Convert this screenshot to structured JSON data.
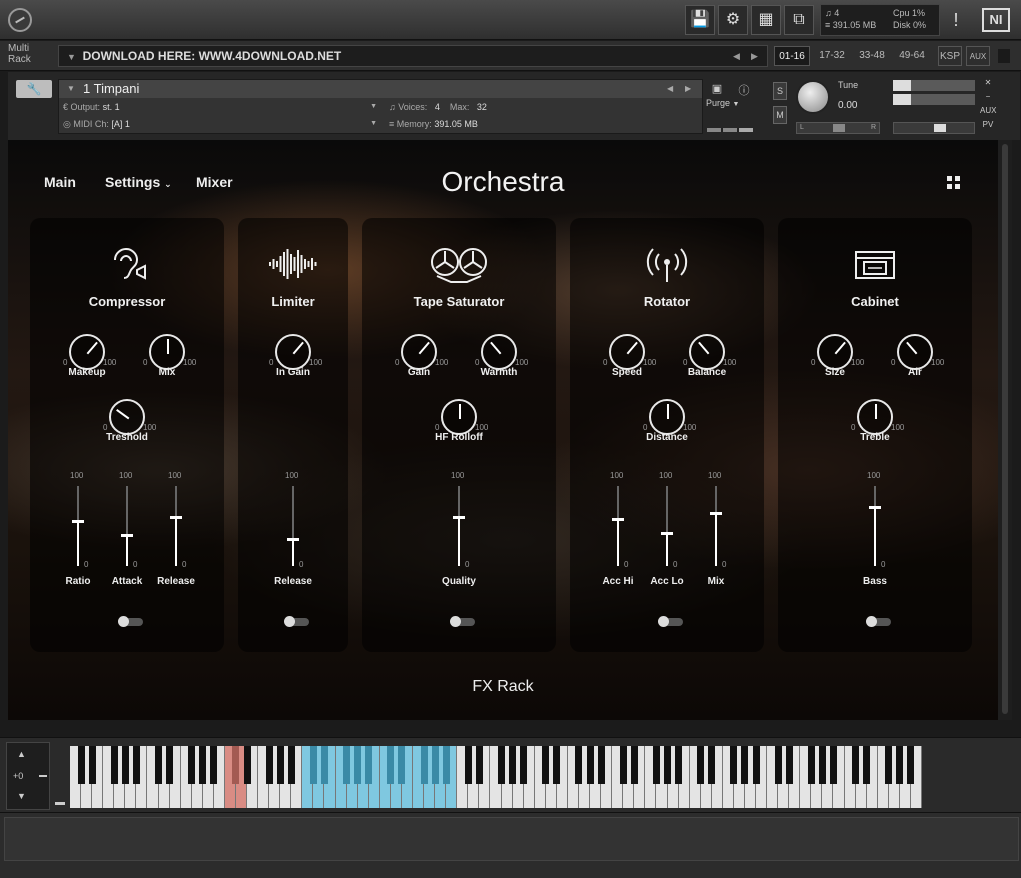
{
  "topbar": {
    "buttons": [
      "save-icon",
      "gear-icon",
      "layout-icon",
      "window-icon"
    ],
    "voices": "4",
    "memory": "391.05 MB",
    "cpu_label": "Cpu",
    "cpu_value": "1%",
    "disk_label": "Disk",
    "disk_value": "0%",
    "warning": "!",
    "ni_logo": "NI"
  },
  "rackbar": {
    "multirack": "Multi Rack",
    "preset": "DOWNLOAD HERE: WWW.4DOWNLOAD.NET",
    "pages": [
      "01-16",
      "17-32",
      "33-48",
      "49-64",
      "KSP",
      "AUX"
    ],
    "active_page": "01-16"
  },
  "instrument": {
    "name": "1 Timpani",
    "output_label": "Output:",
    "output_value": "st. 1",
    "voices_label": "Voices:",
    "voices_value": "4",
    "max_label": "Max:",
    "max_value": "32",
    "midi_label": "MIDI Ch:",
    "midi_value": "[A]  1",
    "memory_label": "Memory:",
    "memory_value": "391.05 MB",
    "purge": "Purge",
    "s": "S",
    "m": "M",
    "tune_label": "Tune",
    "tune_value": "0.00",
    "l": "L",
    "r": "R",
    "aux": "AUX",
    "pv": "PV"
  },
  "main": {
    "nav": {
      "main": "Main",
      "settings": "Settings",
      "mixer": "Mixer"
    },
    "title": "Orchestra",
    "footer": "FX Rack",
    "fx": [
      {
        "name": "Compressor",
        "icon": "ear-icon",
        "knobs": [
          {
            "label": "Makeup",
            "min": "0",
            "max": "100",
            "value": 0.65
          },
          {
            "label": "Mix",
            "min": "0",
            "max": "100",
            "value": 0.5
          }
        ],
        "knobs2": [
          {
            "label": "Treshold",
            "min": "0",
            "max": "100",
            "value": 0.3
          }
        ],
        "sliders": [
          {
            "label": "Ratio",
            "max": "100",
            "min": "0",
            "value": 0.55
          },
          {
            "label": "Attack",
            "max": "100",
            "min": "0",
            "value": 0.38
          },
          {
            "label": "Release",
            "max": "100",
            "min": "0",
            "value": 0.6
          }
        ]
      },
      {
        "name": "Limiter",
        "icon": "waveform-icon",
        "knobs": [
          {
            "label": "In Gain",
            "min": "0",
            "max": "100",
            "value": 0.65
          }
        ],
        "knobs2": [],
        "sliders": [
          {
            "label": "Release",
            "max": "100",
            "min": "0",
            "value": 0.32
          }
        ]
      },
      {
        "name": "Tape Saturator",
        "icon": "tape-reel-icon",
        "knobs": [
          {
            "label": "Gain",
            "min": "0",
            "max": "100",
            "value": 0.65
          },
          {
            "label": "Warmth",
            "min": "0",
            "max": "100",
            "value": 0.35
          }
        ],
        "knobs2": [
          {
            "label": "HF Rolloff",
            "min": "0",
            "max": "100",
            "value": 0.5
          }
        ],
        "sliders": [
          {
            "label": "Quality",
            "max": "100",
            "min": "0",
            "value": 0.6
          }
        ]
      },
      {
        "name": "Rotator",
        "icon": "broadcast-icon",
        "knobs": [
          {
            "label": "Speed",
            "min": "0",
            "max": "100",
            "value": 0.65
          },
          {
            "label": "Balance",
            "min": "0",
            "max": "100",
            "value": 0.35
          }
        ],
        "knobs2": [
          {
            "label": "Distance",
            "min": "0",
            "max": "100",
            "value": 0.5
          }
        ],
        "sliders": [
          {
            "label": "Acc Hi",
            "max": "100",
            "min": "0",
            "value": 0.58
          },
          {
            "label": "Acc Lo",
            "max": "100",
            "min": "0",
            "value": 0.4
          },
          {
            "label": "Mix",
            "max": "100",
            "min": "0",
            "value": 0.65
          }
        ]
      },
      {
        "name": "Cabinet",
        "icon": "amp-cabinet-icon",
        "knobs": [
          {
            "label": "Size",
            "min": "0",
            "max": "100",
            "value": 0.65
          },
          {
            "label": "Air",
            "min": "0",
            "max": "100",
            "value": 0.35
          }
        ],
        "knobs2": [
          {
            "label": "Treble",
            "min": "0",
            "max": "100",
            "value": 0.5
          }
        ],
        "sliders": [
          {
            "label": "Bass",
            "max": "100",
            "min": "0",
            "value": 0.72
          }
        ]
      }
    ]
  },
  "keyboard": {
    "octave": "+0",
    "key_colors": {
      "white": "#e4e4e4",
      "black": "#111111",
      "range": "#7fc8e0",
      "keyswitch": "#d98c84"
    }
  }
}
